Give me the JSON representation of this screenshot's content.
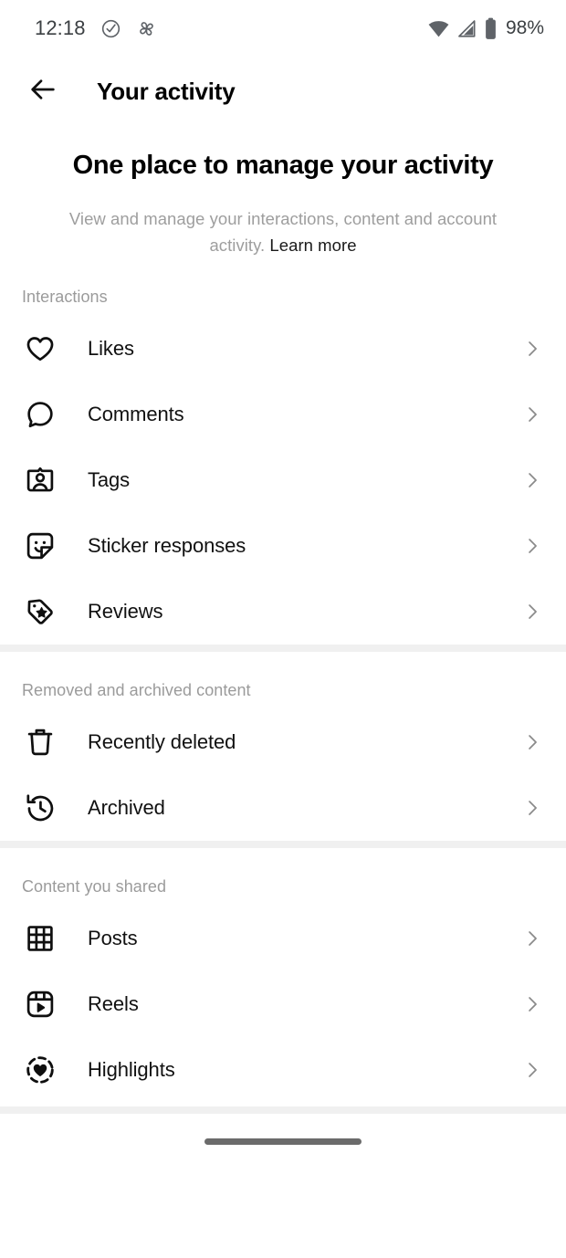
{
  "status_bar": {
    "time": "12:18",
    "battery_percent": "98%",
    "icons": [
      "check-circle-icon",
      "pinwheel-icon",
      "wifi-icon",
      "cellular-signal-icon",
      "battery-icon"
    ]
  },
  "app_bar": {
    "back_label": "back-arrow-icon",
    "title": "Your activity"
  },
  "hero": {
    "title": "One place to manage your activity",
    "description": "View and manage your interactions, content and account activity. ",
    "learn_more": "Learn more"
  },
  "sections": [
    {
      "label": "Interactions",
      "items": [
        {
          "label": "Likes",
          "icon": "heart-icon"
        },
        {
          "label": "Comments",
          "icon": "comment-bubble-icon"
        },
        {
          "label": "Tags",
          "icon": "person-badge-icon"
        },
        {
          "label": "Sticker responses",
          "icon": "sticker-smiley-icon"
        },
        {
          "label": "Reviews",
          "icon": "tag-star-icon"
        }
      ]
    },
    {
      "label": "Removed and archived content",
      "items": [
        {
          "label": "Recently deleted",
          "icon": "trash-icon"
        },
        {
          "label": "Archived",
          "icon": "clock-rewind-icon"
        }
      ]
    },
    {
      "label": "Content you shared",
      "items": [
        {
          "label": "Posts",
          "icon": "grid-icon"
        },
        {
          "label": "Reels",
          "icon": "reels-play-icon"
        },
        {
          "label": "Highlights",
          "icon": "highlights-heart-icon"
        }
      ]
    }
  ],
  "chevron_icon": "chevron-right-icon",
  "colors": {
    "background": "#ffffff",
    "text_primary": "#111111",
    "text_secondary": "#9b9b9b",
    "divider": "#f0f0f0",
    "chevron": "#8a8a8a",
    "home_indicator": "#6b6b6b"
  },
  "nav_bar": {
    "home_indicator": "home-indicator"
  }
}
